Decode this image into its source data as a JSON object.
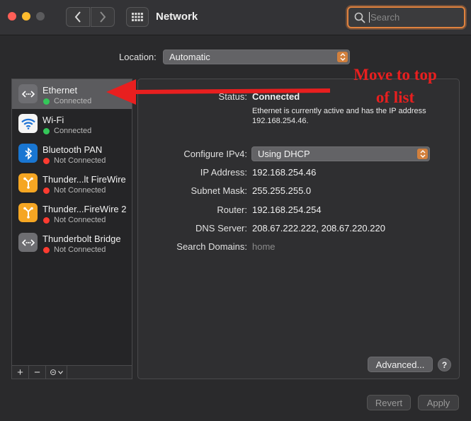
{
  "window": {
    "title": "Network"
  },
  "search": {
    "placeholder": "Search"
  },
  "location": {
    "label": "Location:",
    "value": "Automatic"
  },
  "services": [
    {
      "name": "Ethernet",
      "status": "Connected",
      "state": "connected",
      "icon": "ethernet-icon"
    },
    {
      "name": "Wi-Fi",
      "status": "Connected",
      "state": "connected",
      "icon": "wifi-icon"
    },
    {
      "name": "Bluetooth PAN",
      "status": "Not Connected",
      "state": "disconnected",
      "icon": "bluetooth-icon"
    },
    {
      "name": "Thunder...lt FireWire",
      "status": "Not Connected",
      "state": "disconnected",
      "icon": "firewire-icon"
    },
    {
      "name": "Thunder...FireWire 2",
      "status": "Not Connected",
      "state": "disconnected",
      "icon": "firewire-icon"
    },
    {
      "name": "Thunderbolt Bridge",
      "status": "Not Connected",
      "state": "disconnected",
      "icon": "ethernet-icon"
    }
  ],
  "sidebar_toolbar": {
    "add": "+",
    "remove": "−",
    "action": "⊝"
  },
  "detail": {
    "status_label": "Status:",
    "status_value": "Connected",
    "status_desc": "Ethernet is currently active and has the IP address 192.168.254.46.",
    "ipv4_label": "Configure IPv4:",
    "ipv4_value": "Using DHCP",
    "ip_label": "IP Address:",
    "ip_value": "192.168.254.46",
    "subnet_label": "Subnet Mask:",
    "subnet_value": "255.255.255.0",
    "router_label": "Router:",
    "router_value": "192.168.254.254",
    "dns_label": "DNS Server:",
    "dns_value": "208.67.222.222, 208.67.220.220",
    "domains_label": "Search Domains:",
    "domains_value": "home"
  },
  "buttons": {
    "advanced": "Advanced...",
    "help": "?",
    "revert": "Revert",
    "apply": "Apply"
  },
  "annotation": {
    "line1": "Move to top",
    "line2": "of list",
    "color": "#e81f1f"
  },
  "colors": {
    "accent": "#d2803d",
    "connected": "#34c759",
    "disconnected": "#ff3b30"
  }
}
